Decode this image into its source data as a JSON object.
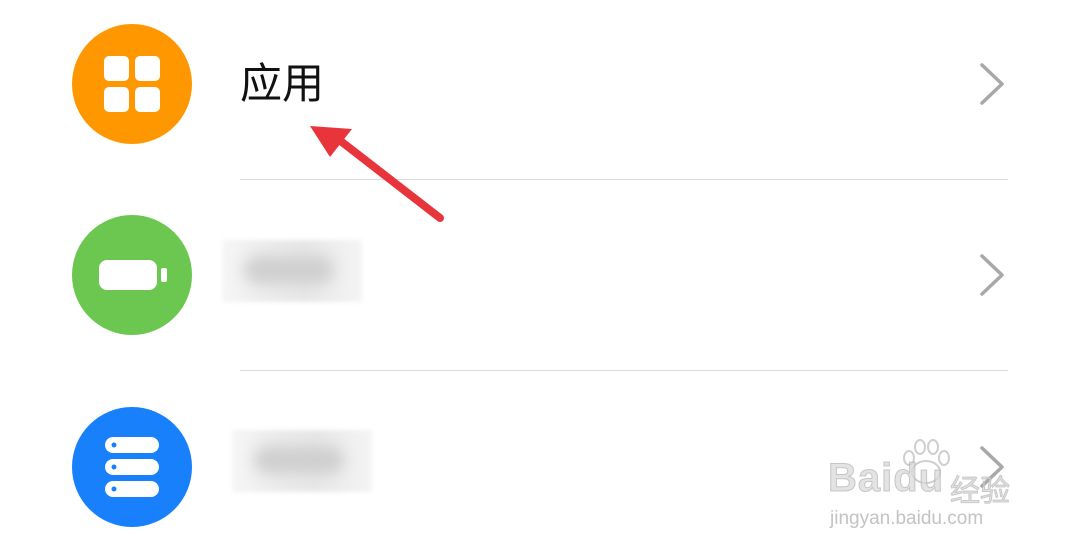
{
  "settings_list": {
    "items": [
      {
        "label": "应用",
        "icon": "apps-grid-icon",
        "icon_color": "#FF9800",
        "label_visible": true
      },
      {
        "label": "",
        "icon": "battery-icon",
        "icon_color": "#6CC751",
        "label_visible": false
      },
      {
        "label": "",
        "icon": "storage-icon",
        "icon_color": "#1780FA",
        "label_visible": false
      }
    ]
  },
  "annotation": {
    "arrow_color": "#E8353B",
    "arrow_target": "应用"
  },
  "watermark": {
    "brand": "Baidu",
    "cn_text": "经验",
    "url": "jingyan.baidu.com"
  }
}
